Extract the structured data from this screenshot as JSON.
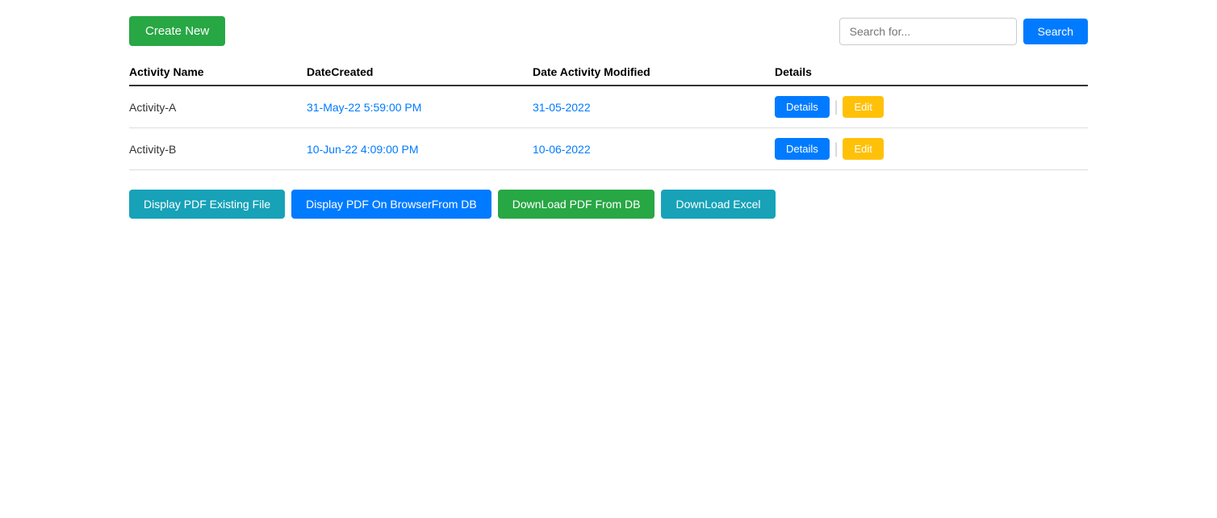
{
  "header": {
    "create_new_label": "Create New",
    "search_placeholder": "Search for...",
    "search_button_label": "Search"
  },
  "table": {
    "columns": [
      {
        "id": "activity_name",
        "label": "Activity Name"
      },
      {
        "id": "date_created",
        "label": "DateCreated"
      },
      {
        "id": "date_activity_modified",
        "label": "Date Activity Modified"
      },
      {
        "id": "details",
        "label": "Details"
      }
    ],
    "rows": [
      {
        "activity_name": "Activity-A",
        "date_created": "31-May-22 5:59:00 PM",
        "date_modified": "31-05-2022",
        "details_label": "Details",
        "edit_label": "Edit"
      },
      {
        "activity_name": "Activity-B",
        "date_created": "10-Jun-22 4:09:00 PM",
        "date_modified": "10-06-2022",
        "details_label": "Details",
        "edit_label": "Edit"
      }
    ]
  },
  "bottom_buttons": {
    "display_pdf_existing": "Display PDF Existing File",
    "display_pdf_browser": "Display PDF On BrowserFrom DB",
    "download_pdf": "DownLoad PDF From DB",
    "download_excel": "DownLoad Excel"
  }
}
